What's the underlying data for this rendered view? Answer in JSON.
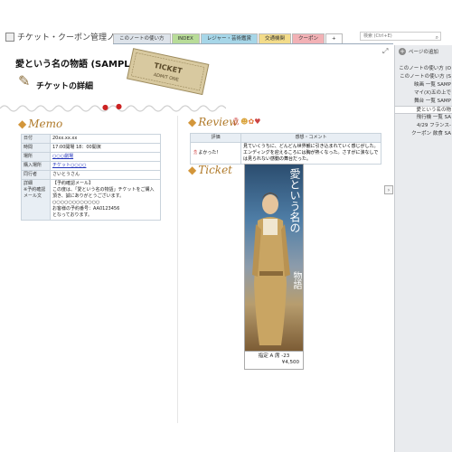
{
  "notebook": {
    "title": "チケット・クーポン管理ノート"
  },
  "tabs": [
    {
      "label": "このノートの使い方",
      "color": "#dde3ea"
    },
    {
      "label": "INDEX",
      "color": "#b8dc98"
    },
    {
      "label": "レジャー・芸術鑑賞",
      "color": "#a6d6e8"
    },
    {
      "label": "交通機関",
      "color": "#f3dc8a"
    },
    {
      "label": "クーポン",
      "color": "#f2b1b5"
    },
    {
      "label": "+",
      "color": "#ffffff"
    }
  ],
  "search": {
    "placeholder": "検索 (Ctrl+E)"
  },
  "page": {
    "title": "愛という名の物語 (SAMPLE)",
    "subtitle": "チケットの詳細",
    "ticket_art_text": "TICKET ADMIT ONE"
  },
  "memo": {
    "heading": "Memo",
    "rows": [
      {
        "key": "日付",
        "value": "20xx.xx.xx"
      },
      {
        "key": "時間",
        "value": "17:00開場 18：00開演"
      },
      {
        "key": "場所",
        "value": "○○○劇場",
        "link": true
      },
      {
        "key": "購入場所",
        "value": "チケット○○○○",
        "link": true
      },
      {
        "key": "同行者",
        "value": "さいとうさん"
      },
      {
        "key": "詳細\n※予約確認メール文",
        "value": "【予約確認メール】\nこの度は、「愛という名の物語」チケットをご購入頂き、誠にありがとうございます。○○○○○○○○○○○○\nお客様の予約番号：AA0123456\nとなっております。"
      }
    ]
  },
  "review": {
    "heading": "Review",
    "col_rating": "評価",
    "col_comment": "感想・コメント",
    "rating": "よかった！",
    "comment": "見ていくうちに、どんどん世界観に引き込まれていく感じがした。エンディングを迎えるころには胸が熱くなった。さすがに涙なしでは見られない感動の舞台だった。"
  },
  "ticket": {
    "heading": "Ticket",
    "poster_title_1": "愛という名の",
    "poster_title_2": "物語",
    "seat": "指定 A 席 -23",
    "price": "¥4,500"
  },
  "right_pane": {
    "add_page": "ページの追加",
    "pages": [
      {
        "label": "このノートの使い方 (O",
        "selected": false
      },
      {
        "label": "このノートの使い方 (S",
        "selected": false
      },
      {
        "label": "映画 一覧 SAMP",
        "selected": false
      },
      {
        "label": "マイ(X)五の上で",
        "selected": false
      },
      {
        "label": "舞台 一覧 SAMP",
        "selected": false
      },
      {
        "label": "愛という名の物",
        "selected": true
      },
      {
        "label": "飛行機 一覧 SA",
        "selected": false
      },
      {
        "label": "4/29 フランス-",
        "selected": false
      },
      {
        "label": "クーポン 飲食 SA",
        "selected": false
      }
    ]
  },
  "colors": {
    "accent": "#b07a2a",
    "table_header": "#e8eef4"
  }
}
